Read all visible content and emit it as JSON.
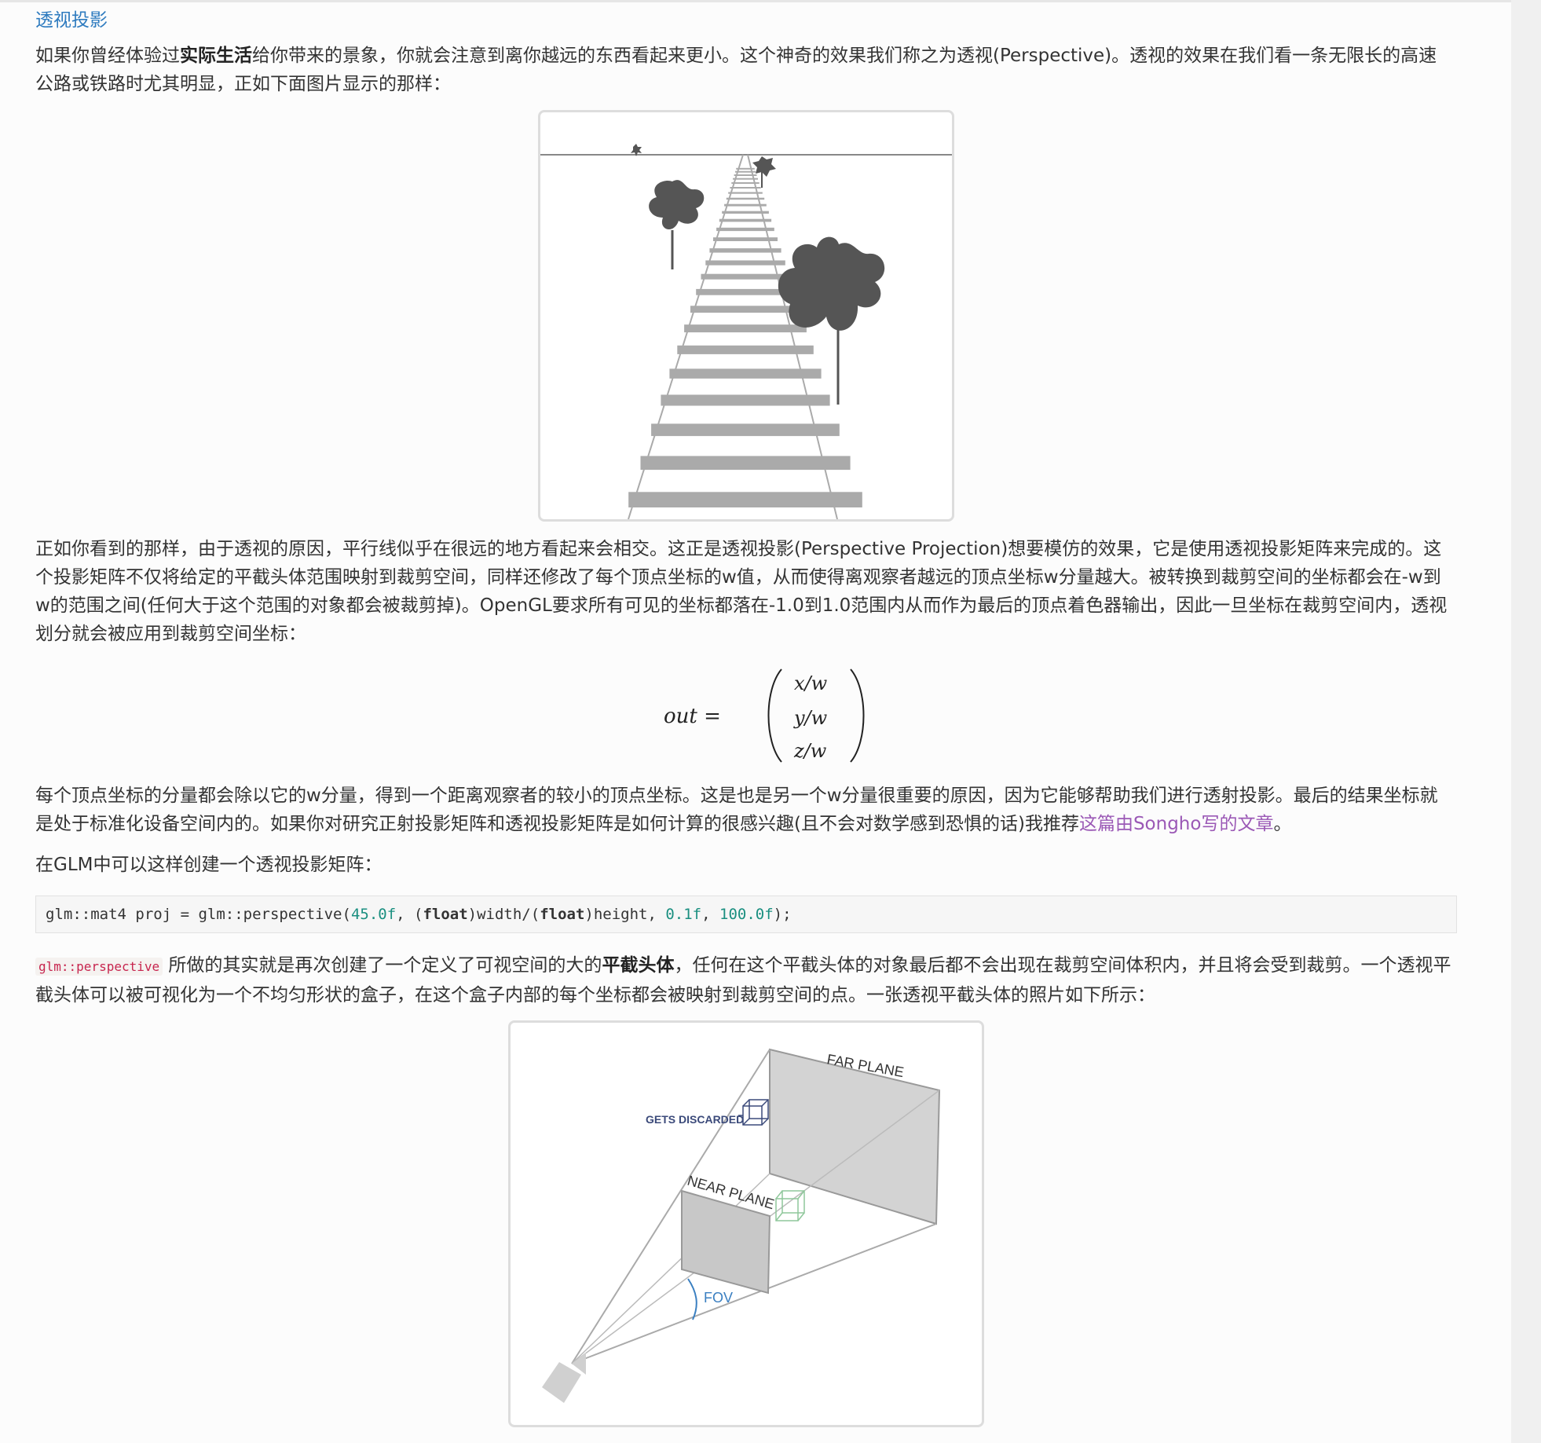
{
  "heading": "透视投影",
  "p1": {
    "pre": "如果你曾经体验过",
    "bold": "实际生活",
    "post": "给你带来的景象，你就会注意到离你越远的东西看起来更小。这个神奇的效果我们称之为透视(Perspective)。透视的效果在我们看一条无限长的高速公路或铁路时尤其明显，正如下面图片显示的那样："
  },
  "p2": "正如你看到的那样，由于透视的原因，平行线似乎在很远的地方看起来会相交。这正是透视投影(Perspective Projection)想要模仿的效果，它是使用透视投影矩阵来完成的。这个投影矩阵不仅将给定的平截头体范围映射到裁剪空间，同样还修改了每个顶点坐标的w值，从而使得离观察者越远的顶点坐标w分量越大。被转换到裁剪空间的坐标都会在-w到w的范围之间(任何大于这个范围的对象都会被裁剪掉)。OpenGL要求所有可见的坐标都落在-1.0到1.0范围内从而作为最后的顶点着色器输出，因此一旦坐标在裁剪空间内，透视划分就会被应用到裁剪空间坐标：",
  "formula": {
    "lhs": "out =",
    "rows": [
      "x/w",
      "y/w",
      "z/w"
    ]
  },
  "p3": {
    "pre": "每个顶点坐标的分量都会除以它的w分量，得到一个距离观察者的较小的顶点坐标。这是也是另一个w分量很重要的原因，因为它能够帮助我们进行透射投影。最后的结果坐标就是处于标准化设备空间内的。如果你对研究正射投影矩阵和透视投影矩阵是如何计算的很感兴趣(且不会对数学感到恐惧的话)我推荐",
    "link": "这篇由Songho写的文章",
    "post": "。"
  },
  "p4": "在GLM中可以这样创建一个透视投影矩阵：",
  "code": {
    "a": "glm::mat4 proj = glm::perspective(",
    "n1": "45.0f",
    "b": ", (",
    "kw1": "float",
    "c": ")width/(",
    "kw2": "float",
    "d": ")height, ",
    "n2": "0.1f",
    "e": ", ",
    "n3": "100.0f",
    "f": ");"
  },
  "p5": {
    "code": "glm::perspective",
    "pre": " 所做的其实就是再次创建了一个定义了可视空间的大的",
    "bold": "平截头体",
    "post": "，任何在这个平截头体的对象最后都不会出现在裁剪空间体积内，并且将会受到裁剪。一个透视平截头体可以被可视化为一个不均匀形状的盒子，在这个盒子内部的每个坐标都会被映射到裁剪空间的点。一张透视平截头体的照片如下所示："
  },
  "figure2": {
    "far": "FAR PLANE",
    "near": "NEAR PLANE",
    "discarded": "GETS DISCARDED",
    "fov": "FOV"
  }
}
